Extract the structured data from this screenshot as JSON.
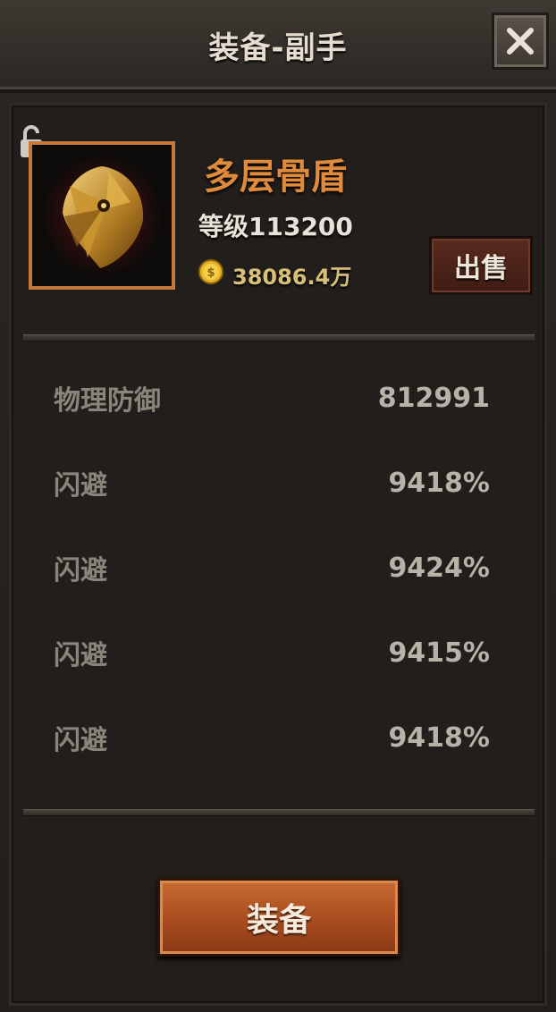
{
  "window": {
    "title": "装备-副手"
  },
  "item": {
    "name": "多层骨盾",
    "level": "等级113200",
    "price": "38086.4万",
    "icon": "shield-icon"
  },
  "actions": {
    "sell_label": "出售",
    "equip_label": "装备"
  },
  "stats": [
    {
      "label": "物理防御",
      "value": "812991"
    },
    {
      "label": "闪避",
      "value": "9418%"
    },
    {
      "label": "闪避",
      "value": "9424%"
    },
    {
      "label": "闪避",
      "value": "9415%"
    },
    {
      "label": "闪避",
      "value": "9418%"
    }
  ],
  "colors": {
    "accent": "#c57a3c",
    "item_name": "#e08a3c",
    "price": "#d9c07a"
  }
}
